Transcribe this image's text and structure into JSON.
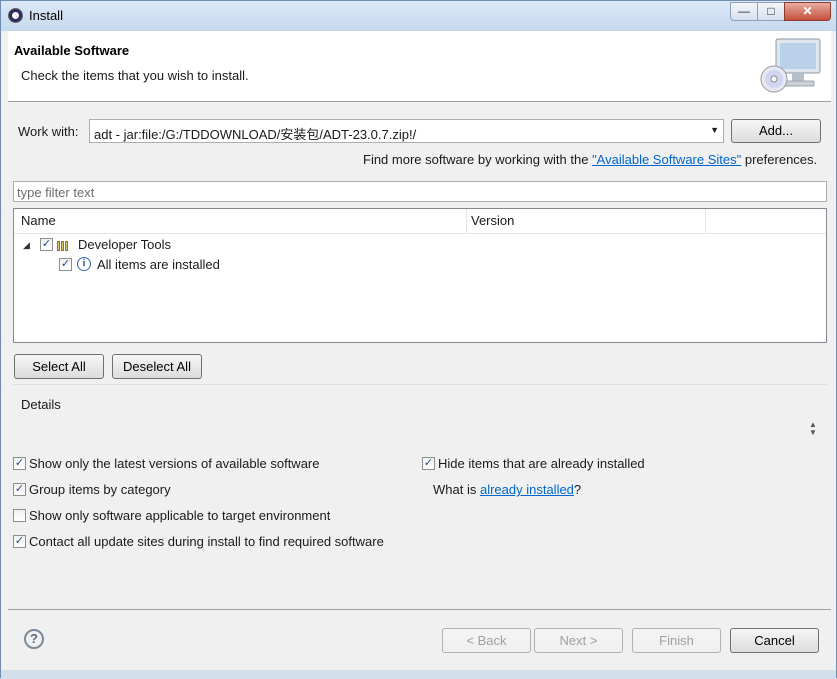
{
  "window": {
    "title": "Install",
    "controls": {
      "minimize": "—",
      "maximize": "□",
      "close": "✕"
    }
  },
  "header": {
    "title": "Available Software",
    "subtitle": "Check the items that you wish to install.",
    "image_icon": "cd-monitor-icon"
  },
  "work_with": {
    "label": "Work with:",
    "value": "adt - jar:file:/G:/TDDOWNLOAD/安装包/ADT-23.0.7.zip!/",
    "add_button": "Add...",
    "more_prefix": "Find more software by working with the",
    "more_link": "\"Available Software Sites\"",
    "more_suffix": "preferences."
  },
  "filter": {
    "placeholder": "type filter text"
  },
  "tree": {
    "columns": [
      "Name",
      "Version"
    ],
    "items": [
      {
        "label": "Developer Tools",
        "checked": true,
        "icon": "package-icon",
        "expanded": true
      },
      {
        "label": "All items are installed",
        "checked": true,
        "icon": "info-icon"
      }
    ]
  },
  "buttons": {
    "select_all": "Select All",
    "deselect_all": "Deselect All"
  },
  "details": {
    "label": "Details"
  },
  "options": {
    "latest_versions": {
      "label": "Show only the latest versions of available software",
      "checked": true
    },
    "group_by_category": {
      "label": "Group items by category",
      "checked": true
    },
    "applicable_only": {
      "label": "Show only software applicable to target environment",
      "checked": false
    },
    "contact_sites": {
      "label": "Contact all update sites during install to find required software",
      "checked": true
    },
    "hide_installed": {
      "label": "Hide items that are already installed",
      "checked": true
    },
    "what_is_prefix": "What is",
    "what_is_link": "already installed",
    "what_is_suffix": "?"
  },
  "footer": {
    "back": "< Back",
    "next": "Next >",
    "finish": "Finish",
    "cancel": "Cancel",
    "help_icon": "?"
  },
  "checkmark": "✓"
}
